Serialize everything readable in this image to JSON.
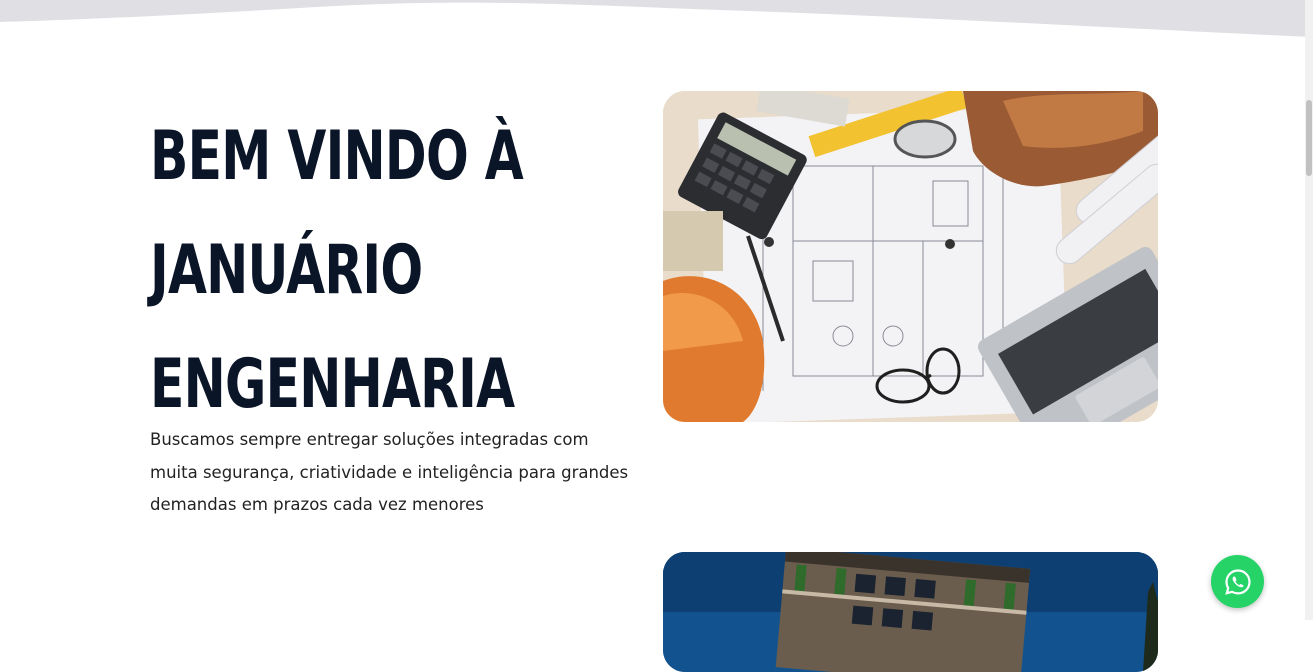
{
  "hero": {
    "title_lines": [
      "BEM VINDO À",
      "JANUÁRIO",
      "ENGENHARIA"
    ],
    "description": "Buscamos sempre entregar soluções integradas com muita segurança, criatividade e inteligência para grandes demandas em prazos cada vez menores"
  },
  "images": {
    "blueprint": "construction-tools-on-blueprint",
    "building": "modern-building-facade"
  },
  "whatsapp": {
    "icon": "whatsapp-icon"
  },
  "colors": {
    "title": "#0b1528",
    "text": "#222222",
    "wave": "#e0e0e4",
    "whatsapp": "#25d366"
  }
}
